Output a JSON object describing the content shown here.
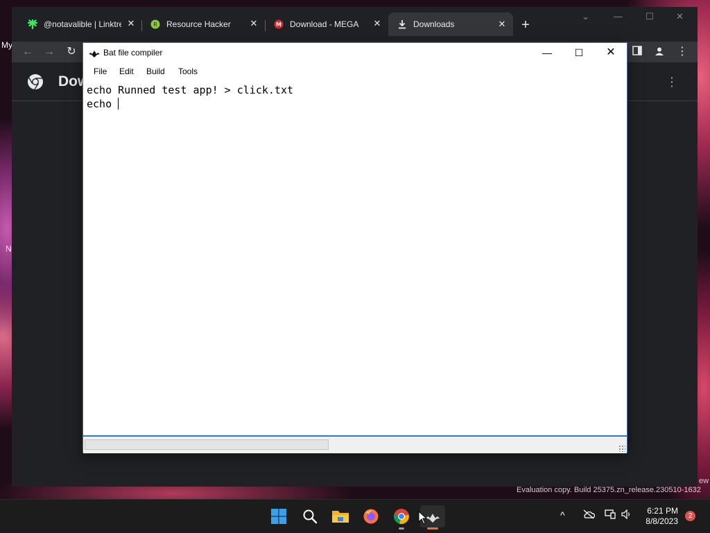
{
  "desktop": {
    "labels": [
      "My",
      "N"
    ]
  },
  "browser": {
    "tabs": [
      {
        "title": "@notavalible | Linktre",
        "icon": "linktree-icon"
      },
      {
        "title": "Resource Hacker",
        "icon": "resource-hacker-icon"
      },
      {
        "title": "Download - MEGA",
        "icon": "mega-icon"
      },
      {
        "title": "Downloads",
        "icon": "download-icon"
      }
    ],
    "page_title": "Dow"
  },
  "app": {
    "title": "Bat file compiler",
    "menu": [
      "File",
      "Edit",
      "Build",
      "Tools"
    ],
    "code_lines": [
      "echo Runned test app! > click.txt",
      "echo "
    ]
  },
  "taskbar": {
    "time": "6:21 PM",
    "date": "8/8/2023",
    "notification_count": "2",
    "pinned": [
      "start-icon",
      "search-icon",
      "file-explorer-icon",
      "firefox-icon",
      "chrome-icon",
      "bat-compiler-icon"
    ]
  },
  "watermark": {
    "text": "Evaluation copy. Build 25375.zn_release.230510-1632",
    "edge_text": "ew"
  },
  "colors": {
    "accent": "#2a78c8",
    "chrome_bg": "#202124",
    "taskbar_bg": "#1c1c1c"
  }
}
